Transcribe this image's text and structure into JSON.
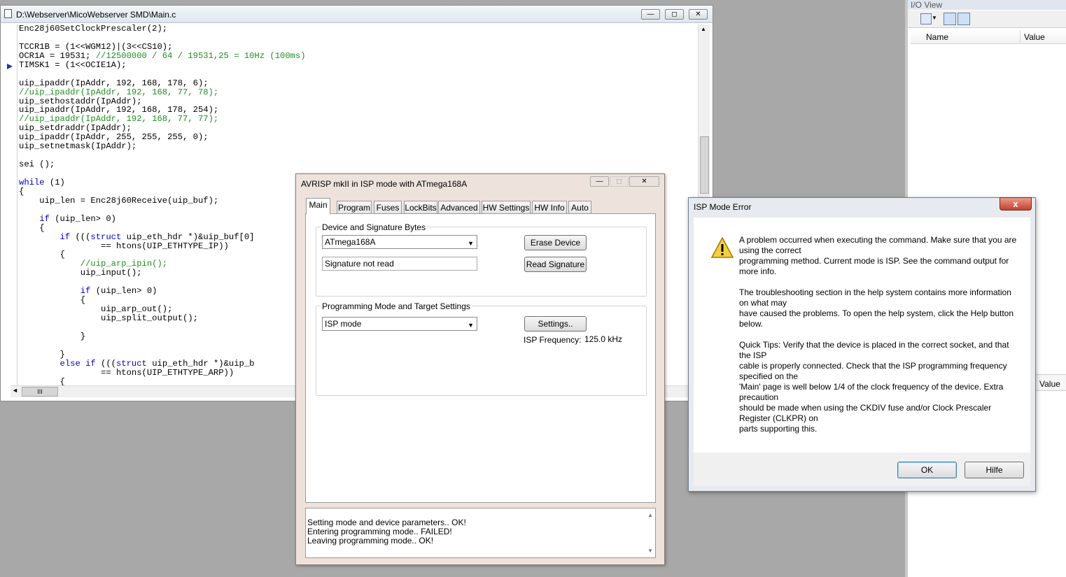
{
  "editor": {
    "title": "D:\\Webserver\\MicoWebserver SMD\\Main.c",
    "min_label": "—",
    "max_label": "◻",
    "close_label": "✕",
    "hscroll_thumb": "III",
    "lines": [
      [
        {
          "t": "Enc28j60SetClockPrescaler(2);",
          "c": "n"
        }
      ],
      [
        {
          "t": "",
          "c": "n"
        }
      ],
      [
        {
          "t": "TCCR1B = (1<<WGM12)|(3<<CS10);",
          "c": "n"
        }
      ],
      [
        {
          "t": "OCR1A = 19531; ",
          "c": "n"
        },
        {
          "t": "//12500000 / 64 / 19531,25 = 10Hz (100ms)",
          "c": "cm"
        }
      ],
      [
        {
          "t": "TIMSK1 = (1<<OCIE1A);",
          "c": "n"
        }
      ],
      [
        {
          "t": "",
          "c": "n"
        }
      ],
      [
        {
          "t": "uip_ipaddr(IpAddr, 192, 168, 178, 6);",
          "c": "n"
        }
      ],
      [
        {
          "t": "//uip_ipaddr(IpAddr, 192, 168, 77, 78);",
          "c": "cm"
        }
      ],
      [
        {
          "t": "uip_sethostaddr(IpAddr);",
          "c": "n"
        }
      ],
      [
        {
          "t": "uip_ipaddr(IpAddr, 192, 168, 178, 254);",
          "c": "n"
        }
      ],
      [
        {
          "t": "//uip_ipaddr(IpAddr, 192, 168, 77, 77);",
          "c": "cm"
        }
      ],
      [
        {
          "t": "uip_setdraddr(IpAddr);",
          "c": "n"
        }
      ],
      [
        {
          "t": "uip_ipaddr(IpAddr, 255, 255, 255, 0);",
          "c": "n"
        }
      ],
      [
        {
          "t": "uip_setnetmask(IpAddr);",
          "c": "n"
        }
      ],
      [
        {
          "t": "",
          "c": "n"
        }
      ],
      [
        {
          "t": "sei ();",
          "c": "n"
        }
      ],
      [
        {
          "t": "",
          "c": "n"
        }
      ],
      [
        {
          "t": "while",
          "c": "kw"
        },
        {
          "t": " (1)",
          "c": "n"
        }
      ],
      [
        {
          "t": "{",
          "c": "n"
        }
      ],
      [
        {
          "t": "    uip_len = Enc28j60Receive(uip_buf);",
          "c": "n"
        }
      ],
      [
        {
          "t": "",
          "c": "n"
        }
      ],
      [
        {
          "t": "    ",
          "c": "n"
        },
        {
          "t": "if",
          "c": "kw"
        },
        {
          "t": " (uip_len> 0)",
          "c": "n"
        }
      ],
      [
        {
          "t": "    {",
          "c": "n"
        }
      ],
      [
        {
          "t": "        ",
          "c": "n"
        },
        {
          "t": "if",
          "c": "kw"
        },
        {
          "t": " (((",
          "c": "n"
        },
        {
          "t": "struct",
          "c": "kw"
        },
        {
          "t": " uip_eth_hdr *)&uip_buf[0]",
          "c": "n"
        }
      ],
      [
        {
          "t": "                == htons(UIP_ETHTYPE_IP))",
          "c": "n"
        }
      ],
      [
        {
          "t": "        {",
          "c": "n"
        }
      ],
      [
        {
          "t": "            ",
          "c": "n"
        },
        {
          "t": "//uip_arp_ipin();",
          "c": "cm"
        }
      ],
      [
        {
          "t": "            uip_input();",
          "c": "n"
        }
      ],
      [
        {
          "t": "",
          "c": "n"
        }
      ],
      [
        {
          "t": "            ",
          "c": "n"
        },
        {
          "t": "if",
          "c": "kw"
        },
        {
          "t": " (uip_len> 0)",
          "c": "n"
        }
      ],
      [
        {
          "t": "            {",
          "c": "n"
        }
      ],
      [
        {
          "t": "                uip_arp_out();",
          "c": "n"
        }
      ],
      [
        {
          "t": "                uip_split_output();",
          "c": "n"
        }
      ],
      [
        {
          "t": "",
          "c": "n"
        }
      ],
      [
        {
          "t": "            }",
          "c": "n"
        }
      ],
      [
        {
          "t": "",
          "c": "n"
        }
      ],
      [
        {
          "t": "        }",
          "c": "n"
        }
      ],
      [
        {
          "t": "        ",
          "c": "n"
        },
        {
          "t": "else if",
          "c": "kw"
        },
        {
          "t": " (((",
          "c": "n"
        },
        {
          "t": "struct",
          "c": "kw"
        },
        {
          "t": " uip_eth_hdr *)&uip_b",
          "c": "n"
        }
      ],
      [
        {
          "t": "                == htons(UIP_ETHTYPE_ARP))",
          "c": "n"
        }
      ],
      [
        {
          "t": "        {",
          "c": "n"
        }
      ]
    ]
  },
  "io_view": {
    "title": "I/O View",
    "col_name": "Name",
    "col_value": "Value",
    "col_value_lower": "Value"
  },
  "avrisp": {
    "title": "AVRISP mkII in ISP mode with ATmega168A",
    "tabs": [
      "Main",
      "Program",
      "Fuses",
      "LockBits",
      "Advanced",
      "HW Settings",
      "HW Info",
      "Auto"
    ],
    "device_group_label": "Device and Signature Bytes",
    "device_selected": "ATmega168A",
    "signature_value": "Signature not read",
    "erase_button": "Erase Device",
    "read_signature_button": "Read Signature",
    "prog_group_label": "Programming Mode and Target Settings",
    "mode_selected": "ISP mode",
    "settings_button": "Settings..",
    "isp_freq_label": "ISP Frequency:",
    "isp_freq_value": "125.0 kHz",
    "log": [
      "Setting mode and device parameters.. OK!",
      "Entering programming mode.. FAILED!",
      "Leaving programming mode.. OK!"
    ]
  },
  "error_dialog": {
    "title": "ISP Mode Error",
    "close_label": "x",
    "paragraphs": [
      [
        "A problem occurred when executing the command. Make sure that you are using the correct",
        "programming method. Current mode is ISP. See the command output for more info."
      ],
      [
        "The troubleshooting section in the help system contains more information on what may",
        "have caused the problems. To open the help system, click the Help button below."
      ],
      [
        "Quick Tips: Verify that the device is placed in the correct socket, and that the ISP",
        "cable is properly connected. Check that the ISP programming frequency specified on the",
        "'Main' page is well below 1/4 of the clock frequency of the device. Extra precaution",
        "should be made when using the CKDIV fuse and/or Clock Prescaler Register (CLKPR) on",
        "parts supporting this."
      ]
    ],
    "ok_button": "OK",
    "help_button": "Hilfe"
  }
}
